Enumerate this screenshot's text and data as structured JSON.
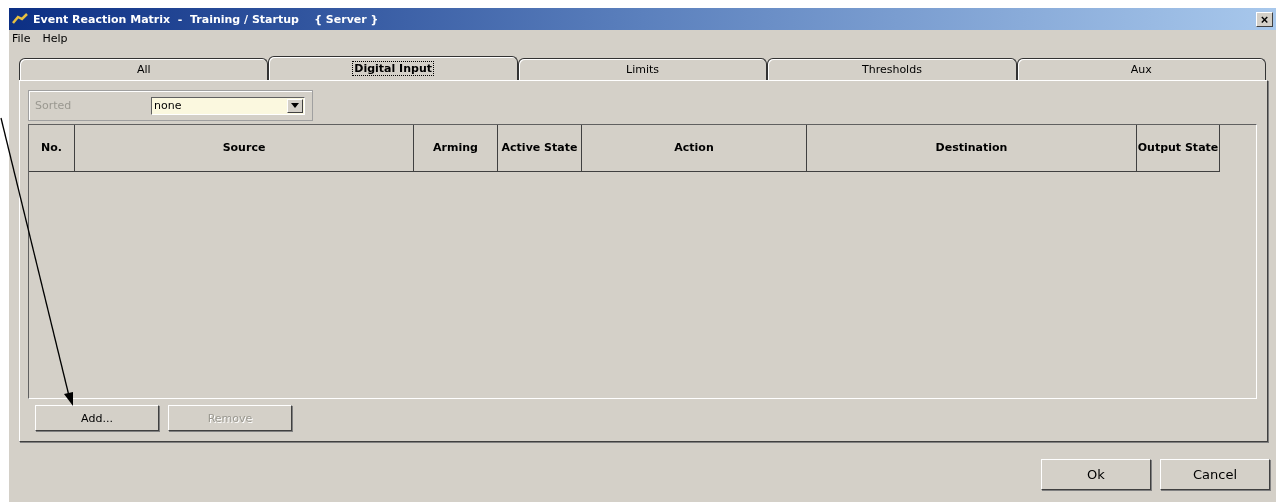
{
  "window": {
    "title": "Event Reaction Matrix  -  Training / Startup    { Server }",
    "close": "×"
  },
  "menu": [
    "File",
    "Help"
  ],
  "tabs": [
    {
      "label": "All",
      "selected": false
    },
    {
      "label": "Digital Input",
      "selected": true
    },
    {
      "label": "Limits",
      "selected": false
    },
    {
      "label": "Thresholds",
      "selected": false
    },
    {
      "label": "Aux",
      "selected": false
    }
  ],
  "sort": {
    "label": "Sorted",
    "disabled": true,
    "value": "none"
  },
  "table": {
    "columns": [
      "No.",
      "Source",
      "Arming",
      "Active State",
      "Action",
      "Destination",
      "Output State"
    ]
  },
  "row_buttons": [
    {
      "label": "Add...",
      "disabled": false
    },
    {
      "label": "Remove",
      "disabled": true
    }
  ],
  "buttons": [
    "Ok",
    "Cancel"
  ]
}
